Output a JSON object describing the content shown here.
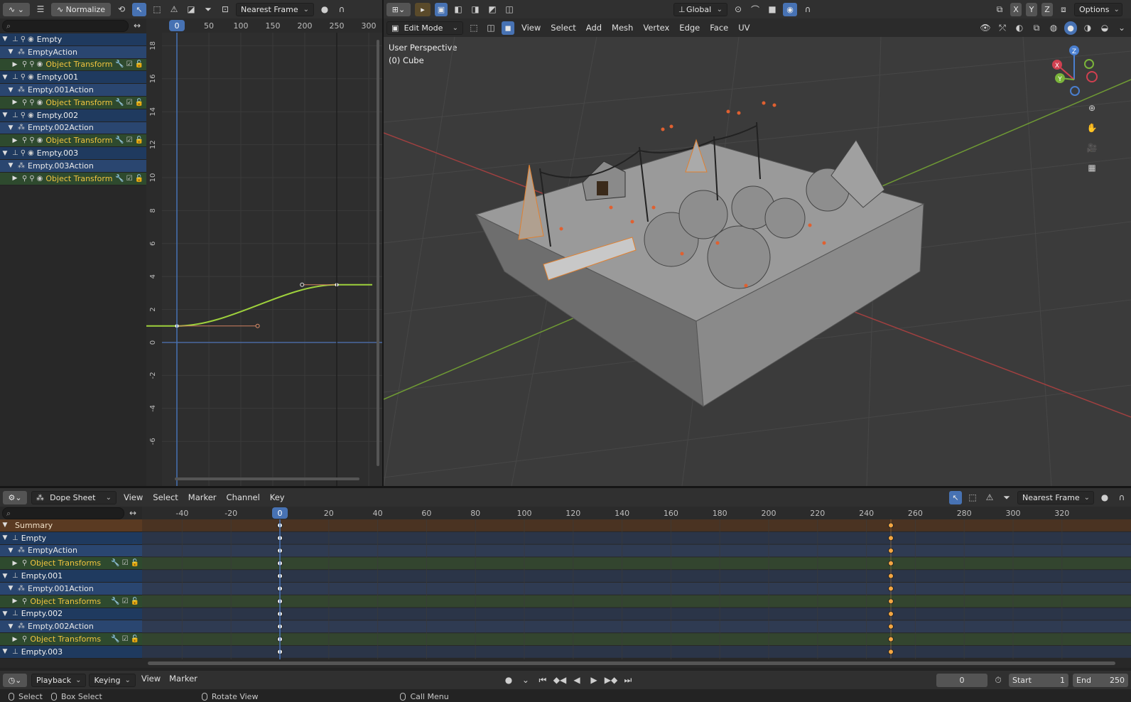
{
  "graph_editor": {
    "header": {
      "normalize_label": "Normalize",
      "snap_mode": "Nearest Frame"
    },
    "frame_ruler": [
      "0",
      "50",
      "100",
      "150",
      "200",
      "250",
      "300"
    ],
    "current_frame": "0",
    "value_ticks": [
      "18",
      "16",
      "14",
      "12",
      "10",
      "8",
      "6",
      "4",
      "2",
      "0",
      "-2",
      "-4",
      "-6"
    ],
    "channels": [
      {
        "type": "obj",
        "label": "Empty"
      },
      {
        "type": "act",
        "label": "EmptyAction"
      },
      {
        "type": "grp",
        "label": "Object Transform"
      },
      {
        "type": "obj",
        "label": "Empty.001"
      },
      {
        "type": "act",
        "label": "Empty.001Action"
      },
      {
        "type": "grp",
        "label": "Object Transform"
      },
      {
        "type": "obj",
        "label": "Empty.002"
      },
      {
        "type": "act",
        "label": "Empty.002Action"
      },
      {
        "type": "grp",
        "label": "Object Transform"
      },
      {
        "type": "obj",
        "label": "Empty.003"
      },
      {
        "type": "act",
        "label": "Empty.003Action"
      },
      {
        "type": "grp",
        "label": "Object Transform"
      }
    ]
  },
  "viewport": {
    "header": {
      "mode": "Edit Mode",
      "menus": [
        "View",
        "Select",
        "Add",
        "Mesh",
        "Vertex",
        "Edge",
        "Face",
        "UV"
      ],
      "orientation": "Global",
      "axes": [
        "X",
        "Y",
        "Z"
      ],
      "options_label": "Options"
    },
    "overlay": {
      "line1": "User Perspective",
      "line2": "(0) Cube"
    },
    "gizmo": {
      "x": "X",
      "y": "Y",
      "z": "Z"
    }
  },
  "dope_sheet": {
    "header": {
      "mode": "Dope Sheet",
      "menus": [
        "View",
        "Select",
        "Marker",
        "Channel",
        "Key"
      ],
      "snap_mode": "Nearest Frame"
    },
    "frame_ruler": [
      "-40",
      "-20",
      "0",
      "20",
      "40",
      "60",
      "80",
      "100",
      "120",
      "140",
      "160",
      "180",
      "200",
      "220",
      "240",
      "260",
      "280",
      "300",
      "320"
    ],
    "current_frame": "0",
    "channels": [
      {
        "type": "sum",
        "label": "Summary"
      },
      {
        "type": "obj",
        "label": "Empty"
      },
      {
        "type": "act",
        "label": "EmptyAction"
      },
      {
        "type": "grp",
        "label": "Object Transforms"
      },
      {
        "type": "obj",
        "label": "Empty.001"
      },
      {
        "type": "act",
        "label": "Empty.001Action"
      },
      {
        "type": "grp",
        "label": "Object Transforms"
      },
      {
        "type": "obj",
        "label": "Empty.002"
      },
      {
        "type": "act",
        "label": "Empty.002Action"
      },
      {
        "type": "grp",
        "label": "Object Transforms"
      },
      {
        "type": "obj",
        "label": "Empty.003"
      }
    ],
    "keyframes": [
      0,
      250
    ]
  },
  "timeline": {
    "menus": [
      "Playback",
      "Keying",
      "View",
      "Marker"
    ],
    "current_frame": "0",
    "start_label": "Start",
    "start_value": "1",
    "end_label": "End",
    "end_value": "250"
  },
  "status_bar": {
    "select": "Select",
    "box_select": "Box Select",
    "rotate_view": "Rotate View",
    "call_menu": "Call Menu"
  },
  "colors": {
    "object_row": "#1f3a5f",
    "action_row": "#2a4670",
    "group_row": "#2e4a2e",
    "summary_row": "#5a3a22",
    "playhead": "#4772b3",
    "curve": "#9ed13c",
    "keyframe": "#f4a742"
  }
}
